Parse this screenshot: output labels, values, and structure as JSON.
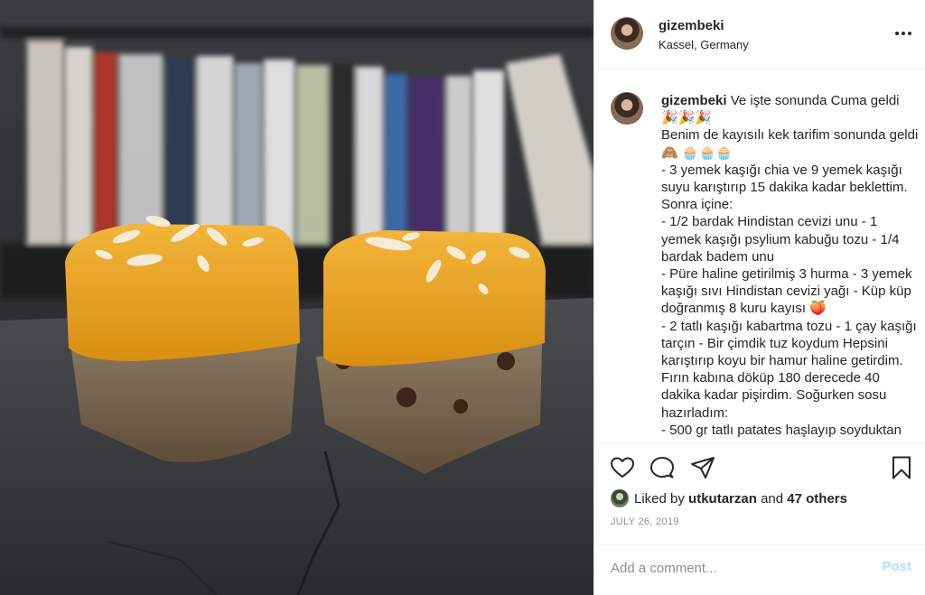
{
  "post": {
    "username": "gizembeki",
    "location": "Kassel, Germany"
  },
  "caption": {
    "username": "gizembeki",
    "text": " Ve işte sonunda Cuma geldi \n🎉🎉🎉\nBenim de kayısılı kek tarifim sonunda geldi🙈 🧁🧁🧁\n- 3 yemek kaşığı chia ve 9 yemek kaşığı suyu karıştırıp 15 dakika kadar beklettim. Sonra içine:\n- 1/2 bardak Hindistan cevizi unu - 1 yemek kaşığı psylium kabuğu tozu - 1/4 bardak badem unu\n- Püre haline getirilmiş 3 hurma - 3 yemek kaşığı sıvı Hindistan cevizi yağı - Küp küp doğranmış 8 kuru kayısı 🍑\n- 2 tatlı kaşığı kabartma tozu - 1 çay kaşığı tarçın - Bir çimdik tuz koydum Hepsini karıştırıp koyu bir hamur haline getirdim. Fırın kabına döküp 180 derecede 40 dakika kadar pişirdim. Soğurken sosu hazırladım:\n- 500 gr tatlı patates haşlayıp soyduktan"
  },
  "likes": {
    "prefix": "Liked by ",
    "user": "utkutarzan",
    "middle": " and ",
    "others": "47 others"
  },
  "date": "JULY 26, 2019",
  "comment_box": {
    "placeholder": "Add a comment...",
    "post_label": "Post"
  },
  "icons": {
    "more": "more-options-icon",
    "like": "heart-icon",
    "comment": "comment-icon",
    "share": "share-icon",
    "save": "bookmark-icon"
  },
  "colors": {
    "text": "#262626",
    "muted": "#8e8e8e",
    "post_disabled": "#b2dffc",
    "divider": "#efefef"
  }
}
